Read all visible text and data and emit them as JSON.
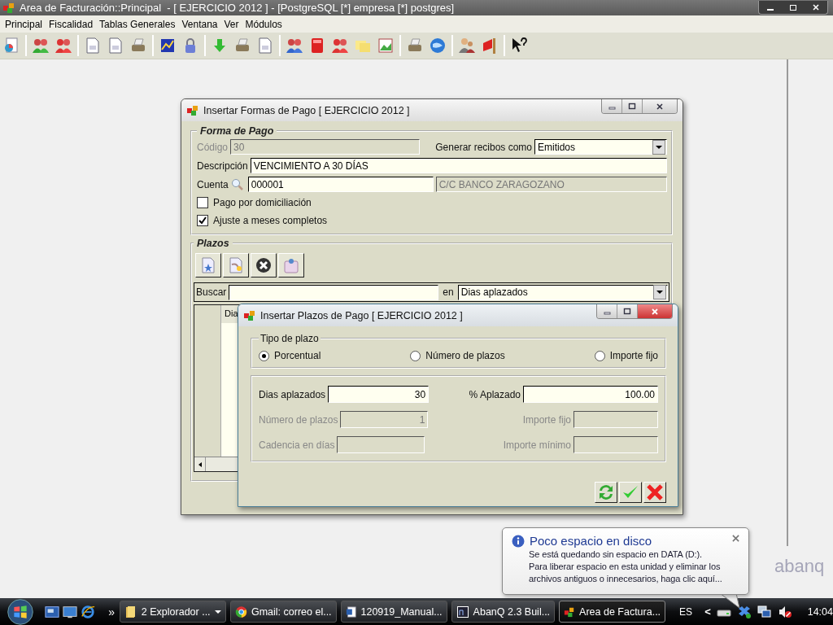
{
  "app_window": {
    "title": "Area de Facturación::Principal  - [ EJERCICIO 2012 ] - [PostgreSQL [*] empresa [*] postgres]"
  },
  "menu": [
    "Principal",
    "Fiscalidad",
    "Tablas Generales",
    "Ventana",
    "Ver",
    "Módulos"
  ],
  "forma_pago_dialog": {
    "title": "Insertar Formas de Pago [ EJERCICIO 2012 ]",
    "section_title": "Forma de Pago",
    "codigo": {
      "label": "Código",
      "value": "30",
      "disabled": true
    },
    "generar": {
      "label": "Generar recibos como",
      "value": "Emitidos"
    },
    "descripcion": {
      "label": "Descripción",
      "value": "VENCIMIENTO A 30 DÍAS"
    },
    "cuenta": {
      "label": "Cuenta",
      "value": "000001",
      "account_name": "C/C BANCO ZARAGOZANO"
    },
    "checkboxes": [
      {
        "label": "Pago por domiciliación",
        "checked": false
      },
      {
        "label": "Ajuste a meses completos",
        "checked": true
      }
    ],
    "plazos": {
      "title": "Plazos",
      "search_label": "Buscar",
      "in_label": "en",
      "search_column": "Dias aplazados",
      "columns": [
        "Dia"
      ]
    }
  },
  "plazos_dialog": {
    "title": "Insertar Plazos de Pago [ EJERCICIO 2012 ]",
    "group_title": "Tipo de plazo",
    "options": [
      {
        "label": "Porcentual",
        "selected": true
      },
      {
        "label": "Número de plazos",
        "selected": false
      },
      {
        "label": "Importe fijo",
        "selected": false
      }
    ],
    "fields": [
      {
        "label": "Dias aplazados",
        "value": "30",
        "disabled": false
      },
      {
        "label": "% Aplazado",
        "value": "100.00",
        "disabled": false
      },
      {
        "label": "Número de plazos",
        "value": "1",
        "disabled": true
      },
      {
        "label": "Importe fijo",
        "disabled": true
      },
      {
        "label": "Cadencia en días",
        "disabled": true
      },
      {
        "label": "Importe mínimo",
        "disabled": true
      }
    ]
  },
  "logo": "abanq",
  "notification": {
    "title": "Poco espacio en disco",
    "lines": [
      "Se está quedando sin espacio en DATA (D:).",
      "Para liberar espacio en esta unidad y eliminar los archivos antiguos o innecesarios, haga clic aquí..."
    ]
  },
  "taskbar": {
    "more": "»",
    "tasks": [
      {
        "label": "2 Explorador ...",
        "selected": false
      },
      {
        "label": "Gmail: correo el...",
        "selected": false
      },
      {
        "label": "120919_Manual...",
        "selected": false
      },
      {
        "label": "AbanQ 2.3 Buil...",
        "selected": false
      },
      {
        "label": "Area de Factura...",
        "selected": true
      }
    ],
    "language": "ES",
    "tray_expand": "<",
    "clock": "14:04"
  }
}
